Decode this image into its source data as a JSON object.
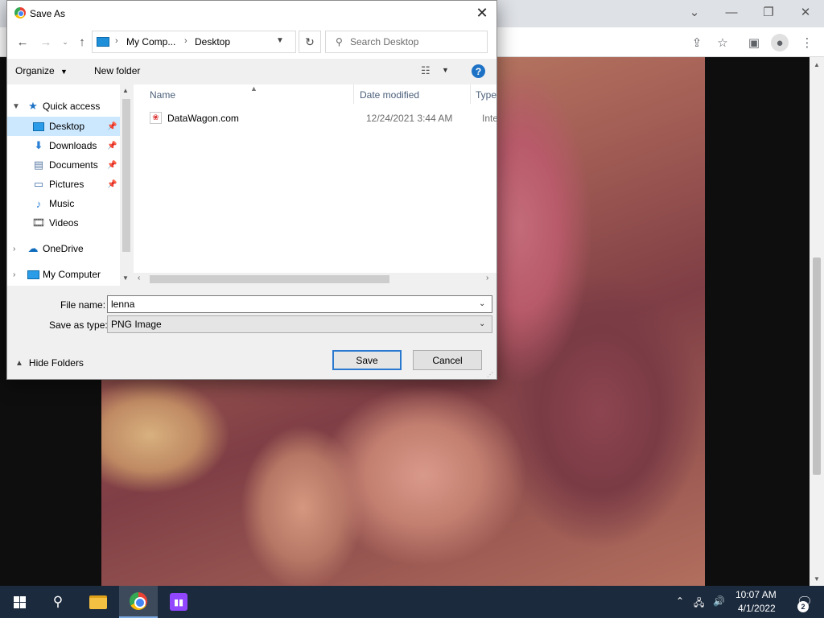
{
  "dialog": {
    "title": "Save As",
    "address": {
      "segments": [
        "My Comp...",
        "Desktop"
      ]
    },
    "search": {
      "placeholder": "Search Desktop"
    },
    "toolbar": {
      "organize": "Organize",
      "new_folder": "New folder"
    },
    "nav": {
      "quick_access": "Quick access",
      "items": [
        "Desktop",
        "Downloads",
        "Documents",
        "Pictures",
        "Music",
        "Videos"
      ],
      "onedrive": "OneDrive",
      "my_computer": "My Computer",
      "selected": "Desktop"
    },
    "columns": {
      "name": "Name",
      "date": "Date modified",
      "type": "Type"
    },
    "files": [
      {
        "name": "DataWagon.com",
        "date": "12/24/2021 3:44 AM",
        "type": "Internet Shortcut"
      }
    ],
    "file_name_label": "File name:",
    "file_name_value": "lenna",
    "save_type_label": "Save as type:",
    "save_type_value": "PNG Image",
    "hide_folders": "Hide Folders",
    "save": "Save",
    "cancel": "Cancel"
  },
  "taskbar": {
    "clock_time": "10:07 AM",
    "clock_date": "4/1/2022",
    "notification_count": "2"
  },
  "colors": {
    "selection": "#cce8ff",
    "accent": "#1e72c6",
    "taskbar": "#1b2a3d"
  }
}
